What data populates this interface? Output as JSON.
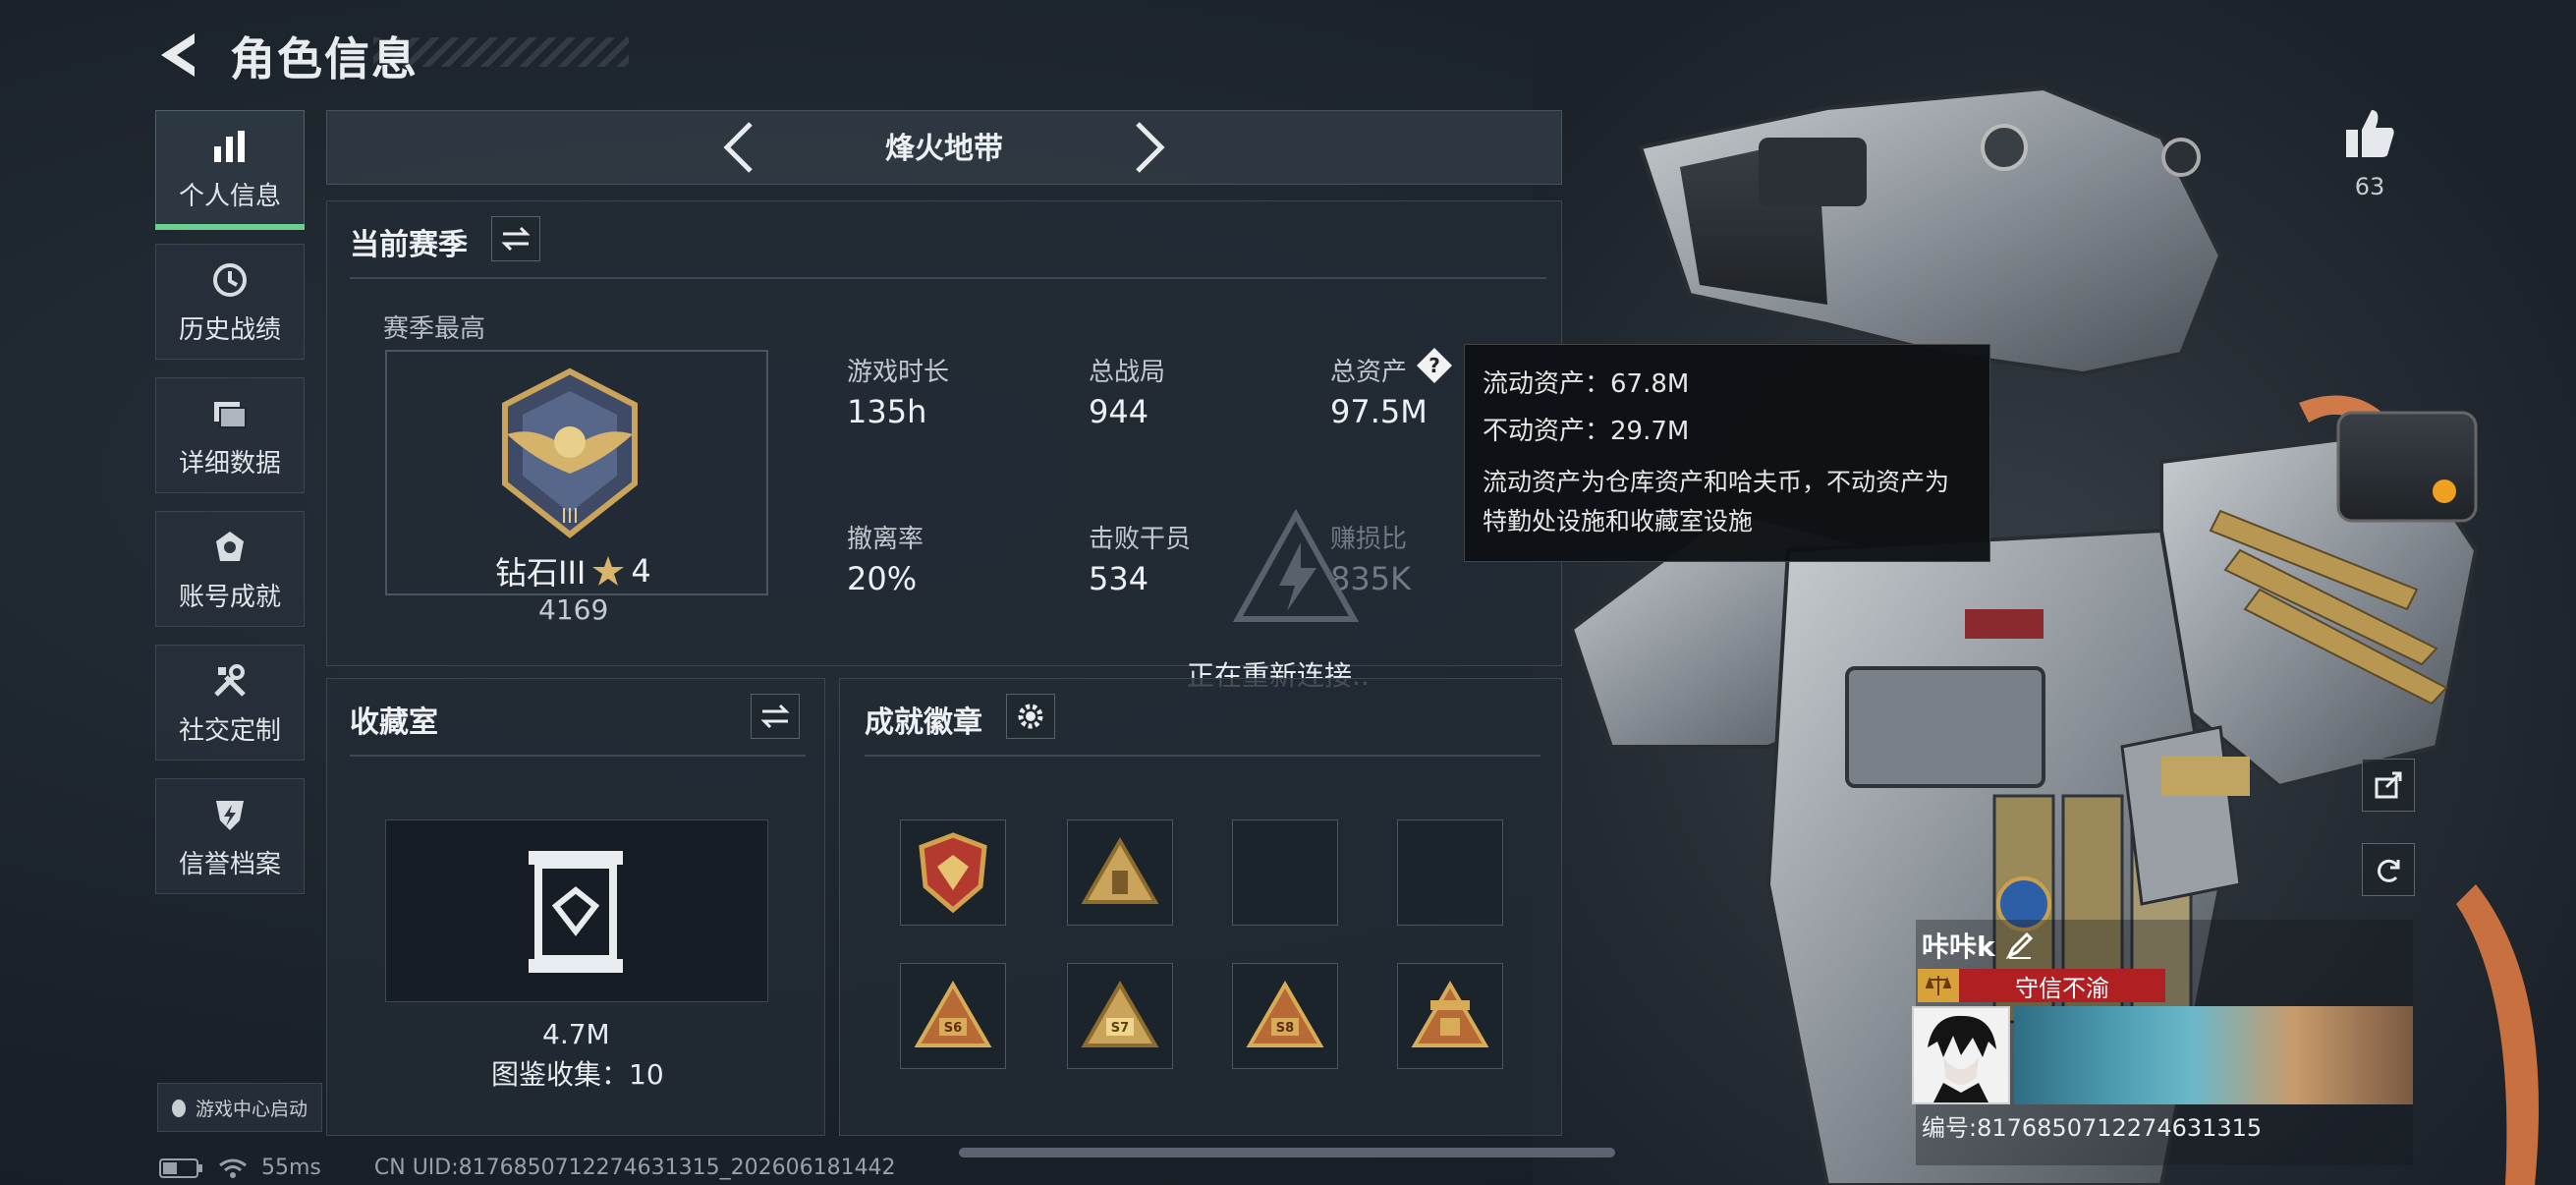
{
  "header": {
    "title": "角色信息"
  },
  "sidebar": {
    "items": [
      {
        "label": "个人信息",
        "icon": "bar-chart-icon",
        "active": true
      },
      {
        "label": "历史战绩",
        "icon": "history-clock-icon"
      },
      {
        "label": "详细数据",
        "icon": "folder-icon"
      },
      {
        "label": "账号成就",
        "icon": "achievement-badge-icon"
      },
      {
        "label": "社交定制",
        "icon": "tools-icon"
      },
      {
        "label": "信誉档案",
        "icon": "lightning-shield-icon"
      }
    ],
    "game_center": "游戏中心启动"
  },
  "map_selector": {
    "name": "烽火地带"
  },
  "season": {
    "title": "当前赛季",
    "best_label": "赛季最高",
    "rank_name": "钻石III",
    "rank_stars": "4",
    "rank_score": "4169",
    "stats": [
      {
        "label": "游戏时长",
        "value": "135h"
      },
      {
        "label": "总战局",
        "value": "944"
      },
      {
        "label": "总资产",
        "value": "97.5M"
      },
      {
        "label": "撤离率",
        "value": "20%"
      },
      {
        "label": "击败干员",
        "value": "534"
      },
      {
        "label": "赚损比",
        "value": "835K"
      }
    ]
  },
  "tooltip": {
    "line1": "流动资产：67.8M",
    "line2": "不动资产：29.7M",
    "desc": "流动资产为仓库资产和哈夫币，不动资产为特勤处设施和收藏室设施"
  },
  "collection": {
    "title": "收藏室",
    "value": "4.7M",
    "collected": "图鉴收集：10"
  },
  "badges": {
    "title": "成就徽章",
    "items": [
      {
        "icon": "shield-badge-icon",
        "label": "",
        "filled": true
      },
      {
        "icon": "triangle-badge-icon",
        "label": "",
        "filled": true
      },
      {
        "icon": "",
        "label": "",
        "filled": false
      },
      {
        "icon": "",
        "label": "",
        "filled": false
      },
      {
        "icon": "triangle-badge-icon",
        "label": "S6",
        "filled": true
      },
      {
        "icon": "triangle-badge-icon",
        "label": "S7",
        "filled": true
      },
      {
        "icon": "triangle-badge-icon",
        "label": "S8",
        "filled": true
      },
      {
        "icon": "triangle-badge-icon",
        "label": "",
        "filled": true
      }
    ]
  },
  "reconnect": "正在重新连接..",
  "profile": {
    "likes": "63",
    "player_name": "咔咔k",
    "title_tag": "守信不渝",
    "uid_line": "编号:8176850712274631315"
  },
  "status_bar": {
    "ping": "55ms",
    "uid": "CN UID:8176850712274631315_202606181442"
  },
  "colors": {
    "accent_green": "#6bd08f",
    "tag_red": "#b01f22",
    "badge_gold": "#c9a45a"
  }
}
